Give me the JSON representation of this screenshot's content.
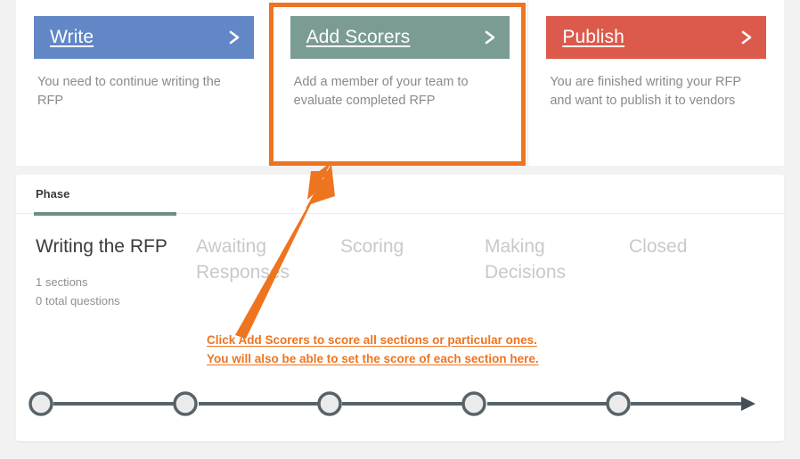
{
  "colors": {
    "blue": "#6287c6",
    "green": "#7a9c94",
    "red": "#dc5a4c",
    "orange": "#ee7420",
    "active_underline": "#6c8f83",
    "timeline": "#56636a",
    "page_background": "#f2f2f2"
  },
  "cards": [
    {
      "title": "Write",
      "description": "You need to continue writing the RFP",
      "chevron_icon": "chevron-right-icon",
      "header_color": "#6287c6",
      "highlighted": false
    },
    {
      "title": "Add Scorers",
      "description": "Add a member of your team to evaluate completed RFP",
      "chevron_icon": "chevron-right-icon",
      "header_color": "#7a9c94",
      "highlighted": true
    },
    {
      "title": "Publish",
      "description": "You are finished writing your RFP and want to publish it to vendors",
      "chevron_icon": "chevron-right-icon",
      "header_color": "#dc5a4c",
      "highlighted": false
    }
  ],
  "phase_panel": {
    "tab_label": "Phase",
    "phases": [
      {
        "name": "Writing the RFP",
        "active": true,
        "meta_line_1": "1 sections",
        "meta_line_2": "0 total questions"
      },
      {
        "name": "Awaiting Responses",
        "active": false
      },
      {
        "name": "Scoring",
        "active": false
      },
      {
        "name": "Making Decisions",
        "active": false
      },
      {
        "name": "Closed",
        "active": false
      }
    ],
    "timeline": {
      "node_count": 5,
      "node_fill": "#ebebeb",
      "node_stroke": "#56636a",
      "line_color": "#56636a"
    }
  },
  "annotation": {
    "line_1": "Click Add Scorers to score all sections or particular ones.",
    "line_2": "You will also be able to set the score of each section here.",
    "color": "#ee7420",
    "highlight_target": "Add Scorers",
    "arrow_icon": "arrow-up-right-icon",
    "box_icon": "highlight-box"
  }
}
